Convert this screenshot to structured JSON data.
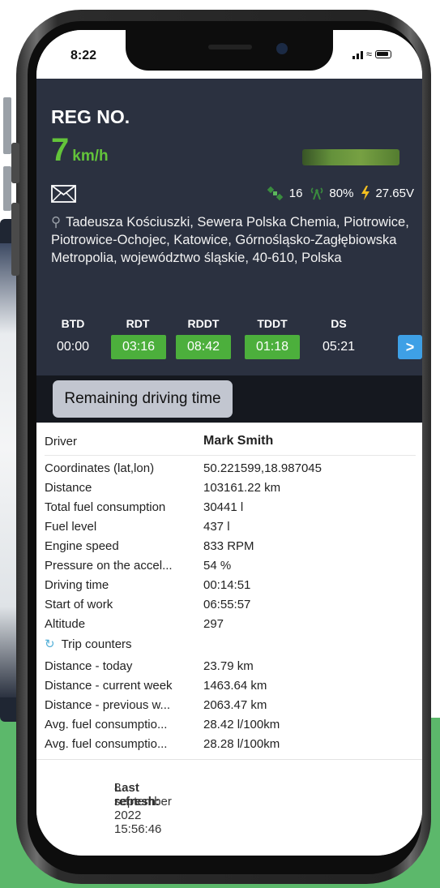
{
  "status_bar": {
    "time": "8:22"
  },
  "header": {
    "reg_label": "REG NO.",
    "speed_value": "7",
    "speed_unit": "km/h",
    "satellites": "16",
    "signal": "80%",
    "voltage": "27.65V",
    "address": "Tadeusza Kościuszki, Sewera Polska Chemia, Piotrowice, Piotrowice-Ochojec, Katowice, Górnośląsko-Zagłębiowska Metropolia, województwo śląskie, 40-610, Polska"
  },
  "timers": [
    {
      "label": "BTD",
      "value": "00:00",
      "highlight": false
    },
    {
      "label": "RDT",
      "value": "03:16",
      "highlight": true
    },
    {
      "label": "RDDT",
      "value": "08:42",
      "highlight": true
    },
    {
      "label": "TDDT",
      "value": "01:18",
      "highlight": true
    },
    {
      "label": "DS",
      "value": "05:21",
      "highlight": false
    }
  ],
  "next_button": ">",
  "tab": {
    "label": "Remaining driving time"
  },
  "info": {
    "driver": {
      "label": "Driver",
      "value": "Mark Smith"
    },
    "rows": [
      {
        "label": "Coordinates (lat,lon)",
        "value": "50.221599,18.987045"
      },
      {
        "label": "Distance",
        "value": "103161.22 km"
      },
      {
        "label": "Total fuel consumption",
        "value": "30441 l"
      },
      {
        "label": "Fuel level",
        "value": "437 l"
      },
      {
        "label": "Engine speed",
        "value": "833 RPM"
      },
      {
        "label": "Pressure on the accel...",
        "value": "54 %"
      },
      {
        "label": "Driving time",
        "value": "00:14:51"
      },
      {
        "label": "Start of work",
        "value": "06:55:57"
      },
      {
        "label": "Altitude",
        "value": "297"
      }
    ],
    "trip_counters_label": "Trip counters",
    "trip_rows": [
      {
        "label": "Distance - today",
        "value": "23.79 km"
      },
      {
        "label": "Distance - current week",
        "value": "1463.64 km"
      },
      {
        "label": "Distance - previous w...",
        "value": "2063.47 km"
      },
      {
        "label": "Avg. fuel consumptio...",
        "value": "28.42 l/100km"
      },
      {
        "label": "Avg. fuel consumptio...",
        "value": "28.28 l/100km"
      }
    ],
    "last_refresh_label": "Last refresh:",
    "last_refresh_value": "8 september 2022 15:56:46"
  },
  "colors": {
    "header_bg": "#2b3140",
    "speed_green": "#63c43a",
    "timer_green": "#4caf3c",
    "next_button_blue": "#3ea0e6",
    "voltage_bolt": "#f4c020",
    "background_green": "#5cb86b"
  },
  "icons": [
    "envelope-icon",
    "satellite-icon",
    "signal-tower-icon",
    "lightning-bolt-icon",
    "location-pin-icon",
    "refresh-icon"
  ]
}
